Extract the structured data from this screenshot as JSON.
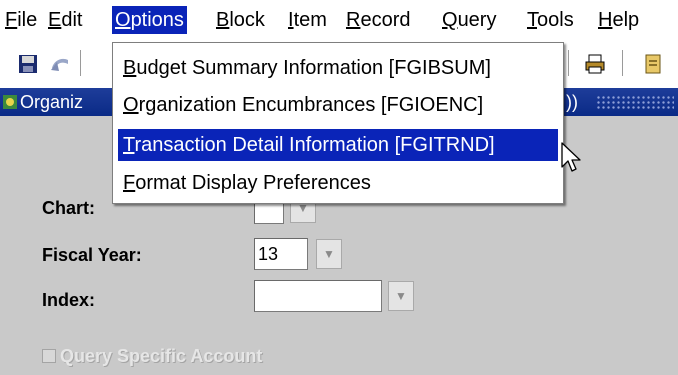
{
  "menubar": {
    "items": [
      {
        "key": "F",
        "rest": "ile"
      },
      {
        "key": "E",
        "rest": "dit"
      },
      {
        "key": "O",
        "rest": "ptions"
      },
      {
        "key": "B",
        "rest": "lock"
      },
      {
        "key": "I",
        "rest": "tem"
      },
      {
        "key": "R",
        "rest": "ecord"
      },
      {
        "key": "Q",
        "rest": "uery"
      },
      {
        "key": "T",
        "rest": "ools"
      },
      {
        "key": "H",
        "rest": "elp"
      }
    ]
  },
  "window": {
    "title_visible": "Organiz",
    "title_tail": "))"
  },
  "options_menu": {
    "items": [
      {
        "key": "B",
        "rest": "udget Summary Information [FGIBSUM]"
      },
      {
        "key": "O",
        "rest": "rganization Encumbrances [FGIOENC]"
      },
      {
        "key": "T",
        "rest": "ransaction Detail Information [FGITRND]"
      },
      {
        "key": "F",
        "rest": "ormat Display Preferences"
      }
    ],
    "selected_index": 2
  },
  "form": {
    "chart_label": "Chart:",
    "chart_value": "",
    "fiscal_year_label": "Fiscal Year:",
    "fiscal_year_value": "13",
    "index_label": "Index:",
    "index_value": "",
    "query_specific_account_label": "Query Specific Account",
    "query_specific_account_checked": false
  },
  "colors": {
    "highlight": "#0a24b8",
    "form_background": "#c9c9c9",
    "title_bar": "#0a2a86"
  }
}
